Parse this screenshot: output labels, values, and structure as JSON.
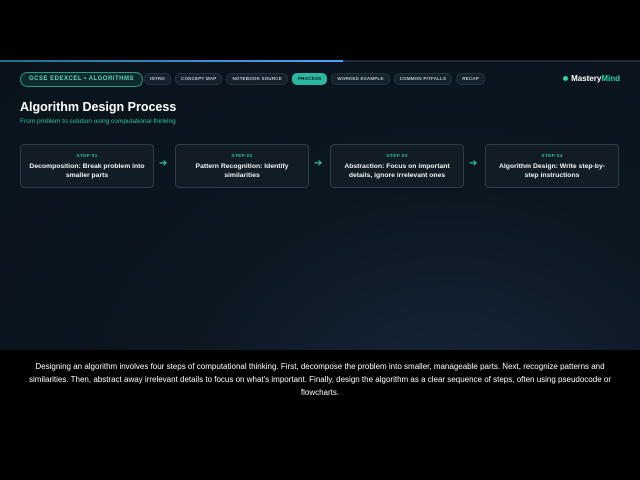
{
  "header": {
    "course_label": "GCSE EDEXCEL • ALGORITHMS",
    "tabs": [
      {
        "label": "INTRO",
        "active": false
      },
      {
        "label": "CONCEPT MAP",
        "active": false
      },
      {
        "label": "NOTEBOOK SOURCE",
        "active": false
      },
      {
        "label": "PROCESS",
        "active": true
      },
      {
        "label": "WORKED EXAMPLE",
        "active": false
      },
      {
        "label": "COMMON PITFALLS",
        "active": false
      },
      {
        "label": "RECAP",
        "active": false
      }
    ],
    "brand": {
      "part1": "Mastery",
      "part2": "Mind"
    }
  },
  "slide": {
    "title": "Algorithm Design Process",
    "subtitle": "From problem to solution using computational thinking",
    "steps": [
      {
        "num": "STEP 01",
        "text": "Decomposition: Break problem into smaller parts"
      },
      {
        "num": "STEP 02",
        "text": "Pattern Recognition: Identify similarities"
      },
      {
        "num": "STEP 03",
        "text": "Abstraction: Focus on important details, ignore irrelevant ones"
      },
      {
        "num": "STEP 04",
        "text": "Algorithm Design: Write step-by-step instructions"
      }
    ],
    "arrow_glyph": "➔"
  },
  "caption": {
    "text": "Designing an algorithm involves four steps of computational thinking. First, decompose the problem into smaller, manageable parts. Next, recognize patterns and similarities. Then, abstract away irrelevant details to focus on what's important. Finally, design the algorithm as a clear sequence of steps, often using pseudocode or flowcharts."
  },
  "colors": {
    "accent": "#2bbfa0",
    "background": "#0a131b",
    "progress": "#4fa3ff"
  }
}
